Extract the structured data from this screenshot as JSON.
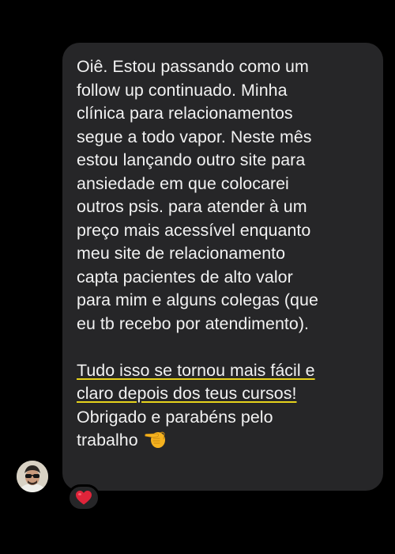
{
  "message": {
    "line1": "Oiê. Estou passando como um",
    "line2": "follow up continuado. Minha",
    "line3": "clínica para relacionamentos",
    "line4": "segue a todo vapor. Neste mês",
    "line5": "estou lançando outro site para",
    "line6": "ansiedade em que colocarei",
    "line7": "outros psis. para atender à um",
    "line8": "preço mais acessível enquanto",
    "line9": "meu site de relacionamento",
    "line10": "capta pacientes de alto valor",
    "line11": "para mim e alguns colegas (que",
    "line12": "eu tb recebo por atendimento).",
    "highlight1": "Tudo isso se tornou mais fácil e",
    "highlight2": "claro depois dos teus cursos!",
    "closing1": "Obrigado e parabéns pelo",
    "closing2": "trabalho"
  },
  "icons": {
    "emoji": "backhand-index-pointing-left",
    "reaction": "red-heart",
    "avatar": "user-avatar"
  },
  "colors": {
    "background": "#000000",
    "bubble": "#262628",
    "text": "#f2f2f2",
    "highlight_underline": "#e6d21c",
    "heart": "#e0243a"
  }
}
